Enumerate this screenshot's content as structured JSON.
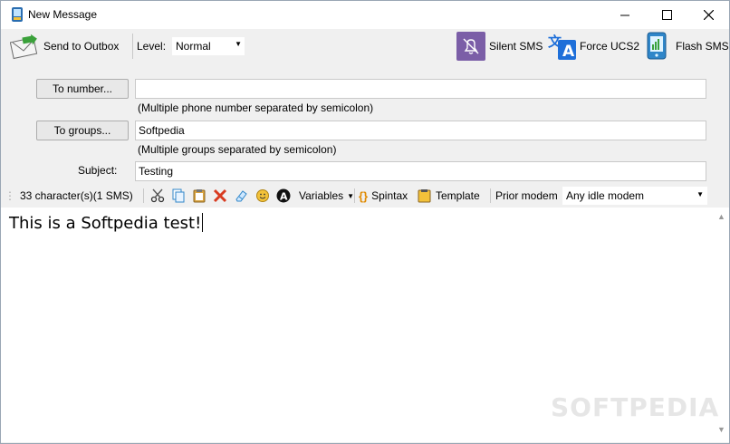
{
  "window": {
    "title": "New Message"
  },
  "toolbar": {
    "send_label": "Send to Outbox",
    "level_label": "Level:",
    "level_value": "Normal",
    "silent_sms_label": "Silent SMS",
    "force_ucs2_label": "Force UCS2",
    "flash_sms_label": "Flash SMS"
  },
  "form": {
    "to_number_button": "To number...",
    "to_number_value": "",
    "to_number_hint": "(Multiple phone number separated by semicolon)",
    "to_groups_button": "To groups...",
    "to_groups_value": "Softpedia",
    "to_groups_hint": "(Multiple groups separated by semicolon)",
    "subject_label": "Subject:",
    "subject_value": "Testing"
  },
  "editor_toolbar": {
    "char_count": "33 character(s)(1 SMS)",
    "variables_label": "Variables",
    "spintax_label": "Spintax",
    "template_label": "Template",
    "prior_modem_label": "Prior modem",
    "prior_modem_value": "Any idle modem"
  },
  "editor": {
    "body_text": "This is a Softpedia test!"
  },
  "watermark": "SOFTPEDIA",
  "colors": {
    "accent_purple": "#7b5ea7",
    "ucs2_blue": "#1e6fd9",
    "send_green": "#3aa13a",
    "delete_red": "#d83b20"
  }
}
